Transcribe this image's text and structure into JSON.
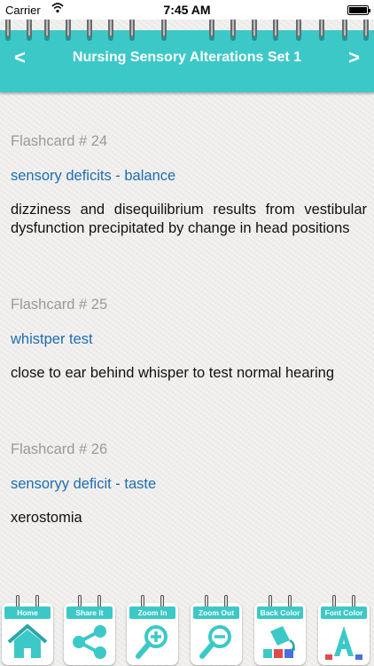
{
  "status_bar": {
    "carrier": "Carrier",
    "time": "7:45 AM"
  },
  "header": {
    "prev_label": "<",
    "title": "Nursing Sensory Alterations Set 1",
    "next_label": ">"
  },
  "cards": [
    {
      "number": "Flashcard # 24",
      "question": "sensory deficits - balance",
      "answer": "dizziness and disequilibrium results from vestibular dysfunction precipitated by change in head positions"
    },
    {
      "number": "Flashcard # 25",
      "question": "whistper test",
      "answer": "close to ear behind whisper to test normal hearing"
    },
    {
      "number": "Flashcard # 26",
      "question": "sensoryy deficit - taste",
      "answer": "xerostomia"
    }
  ],
  "toolbar": {
    "home": "Home",
    "share": "Share it",
    "zoom_in": "Zoom In",
    "zoom_out": "Zoom Out",
    "back_color": "Back Color",
    "font_color": "Font Color"
  },
  "colors": {
    "accent": "#3dc8c8",
    "question": "#1f6db0",
    "muted": "#9a9a9a"
  }
}
